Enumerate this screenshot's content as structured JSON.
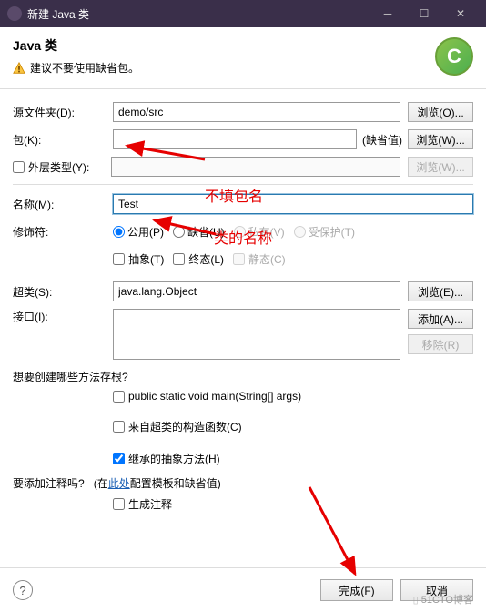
{
  "window": {
    "title": "新建 Java 类"
  },
  "header": {
    "title": "Java 类",
    "warning": "建议不要使用缺省包。"
  },
  "labels": {
    "sourceFolder": "源文件夹(D):",
    "pkg": "包(K):",
    "enclosing": "外层类型(Y):",
    "name": "名称(M):",
    "modifiers": "修饰符:",
    "superclass": "超类(S):",
    "interfaces": "接口(I):"
  },
  "values": {
    "sourceFolder": "demo/src",
    "pkg": "",
    "pkgDefault": "(缺省值)",
    "enclosing": "",
    "name": "Test",
    "superclass": "java.lang.Object"
  },
  "buttons": {
    "browseO": "浏览(O)...",
    "browseW": "浏览(W)...",
    "browseW2": "浏览(W)...",
    "browseE": "浏览(E)...",
    "addA": "添加(A)...",
    "removeR": "移除(R)",
    "finish": "完成(F)",
    "cancel": "取消"
  },
  "modifiers": {
    "public": "公用(P)",
    "default": "缺省(U)",
    "private": "私有(V)",
    "protected": "受保护(T)",
    "abstract": "抽象(T)",
    "final": "终态(L)",
    "static": "静态(C)"
  },
  "stubs": {
    "question": "想要创建哪些方法存根?",
    "main": "public static void main(String[] args)",
    "ctor": "来自超类的构造函数(C)",
    "inherit": "继承的抽象方法(H)"
  },
  "comments": {
    "question": "要添加注释吗?",
    "hint1": "(在",
    "link": "此处",
    "hint2": "配置模板和缺省值)",
    "gen": "生成注释"
  },
  "annotations": {
    "a1": "不填包名",
    "a2": "类的名称"
  },
  "watermark": "51CTO博客"
}
